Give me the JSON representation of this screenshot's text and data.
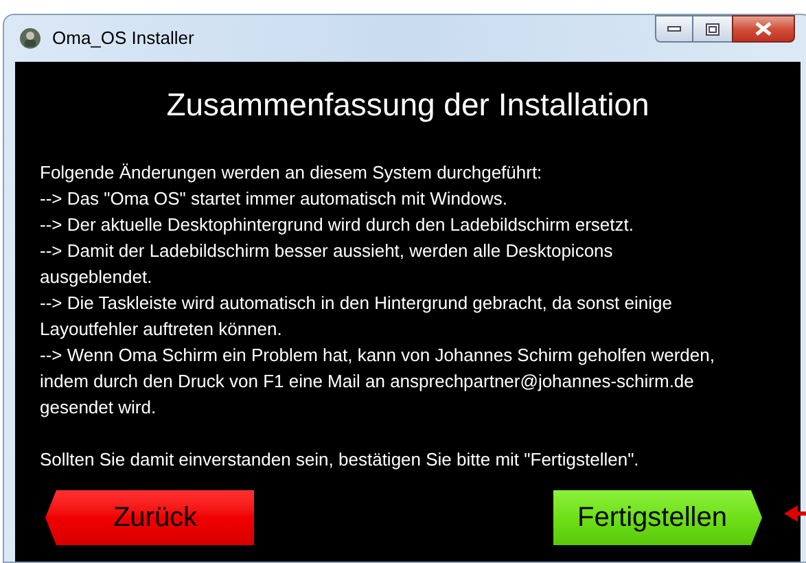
{
  "window": {
    "title": "Oma_OS Installer"
  },
  "heading": "Zusammenfassung der Installation",
  "lines": [
    "Folgende Änderungen werden an diesem System durchgeführt:",
    "--> Das \"Oma OS\" startet immer automatisch mit Windows.",
    "--> Der aktuelle Desktophintergrund wird durch den Ladebildschirm ersetzt.",
    "--> Damit der Ladebildschirm besser aussieht, werden alle Desktopicons",
    "ausgeblendet.",
    "--> Die Taskleiste wird automatisch in den Hintergrund gebracht, da sonst einige",
    "Layoutfehler auftreten können.",
    "--> Wenn Oma Schirm ein Problem hat, kann von Johannes Schirm geholfen werden,",
    "indem durch den Druck von F1 eine Mail an ansprechpartner@johannes-schirm.de",
    "gesendet wird."
  ],
  "confirmation": "Sollten Sie damit einverstanden sein, bestätigen Sie bitte mit \"Fertigstellen\".",
  "buttons": [
    {
      "label": "Zurück",
      "kind": "back"
    },
    {
      "label": "Fertigstellen",
      "kind": "finish"
    }
  ]
}
